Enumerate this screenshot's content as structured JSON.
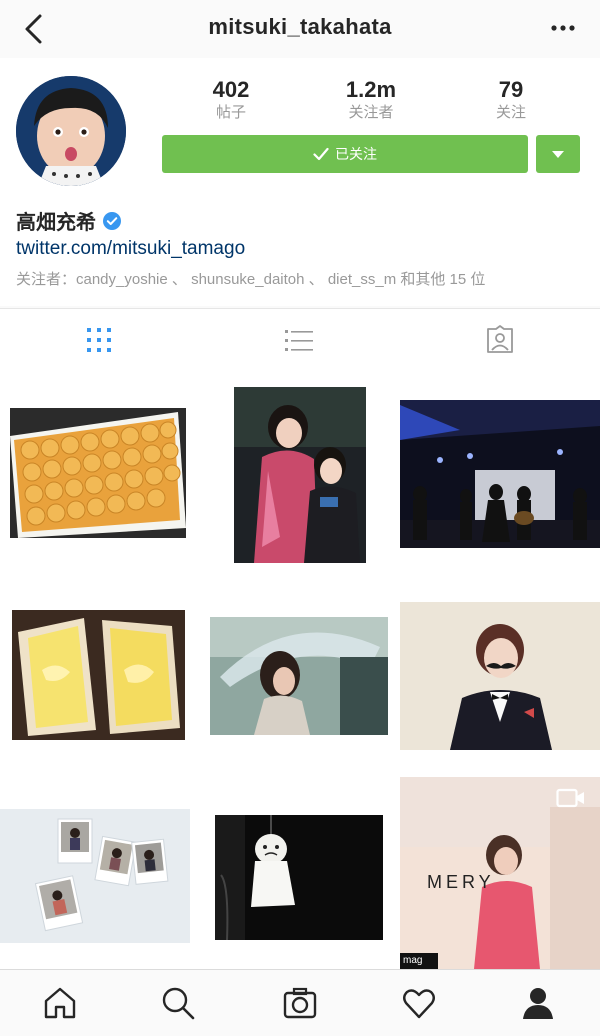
{
  "header": {
    "username": "mitsuki_takahata",
    "back_icon": "chevron-left-icon",
    "more_icon": "more-dots-icon"
  },
  "profile": {
    "stats": [
      {
        "value": "402",
        "label": "帖子"
      },
      {
        "value": "1.2m",
        "label": "关注者"
      },
      {
        "value": "79",
        "label": "关注"
      }
    ],
    "follow_button": "已关注",
    "name": "高畑充希",
    "website": "twitter.com/mitsuki_tamago",
    "followed_by": "关注者：candy_yoshie 、 shunsuke_daitoh 、 diet_ss_m 和其他 15 位",
    "accent_color": "#70c050",
    "link_color": "#003569"
  },
  "tabs": [
    {
      "name": "grid-view",
      "icon": "grid-icon",
      "active": true
    },
    {
      "name": "list-view",
      "icon": "list-icon",
      "active": false
    },
    {
      "name": "tagged",
      "icon": "tagged-person-icon",
      "active": false
    }
  ],
  "posts": [
    {
      "subject": "egg tarts tray"
    },
    {
      "subject": "two people photo"
    },
    {
      "subject": "stage performance"
    },
    {
      "subject": "egg sandwich"
    },
    {
      "subject": "umbrella girl"
    },
    {
      "subject": "mustache portrait"
    },
    {
      "subject": "polaroids on wall"
    },
    {
      "subject": "teru teru bozu doll"
    },
    {
      "subject": "video",
      "overlay_text": "MERY",
      "badge": "mag"
    }
  ],
  "bottom_nav": [
    {
      "name": "home",
      "icon": "home-icon"
    },
    {
      "name": "search",
      "icon": "search-icon"
    },
    {
      "name": "camera",
      "icon": "camera-icon"
    },
    {
      "name": "activity",
      "icon": "heart-icon"
    },
    {
      "name": "profile",
      "icon": "person-icon",
      "active": true
    }
  ]
}
